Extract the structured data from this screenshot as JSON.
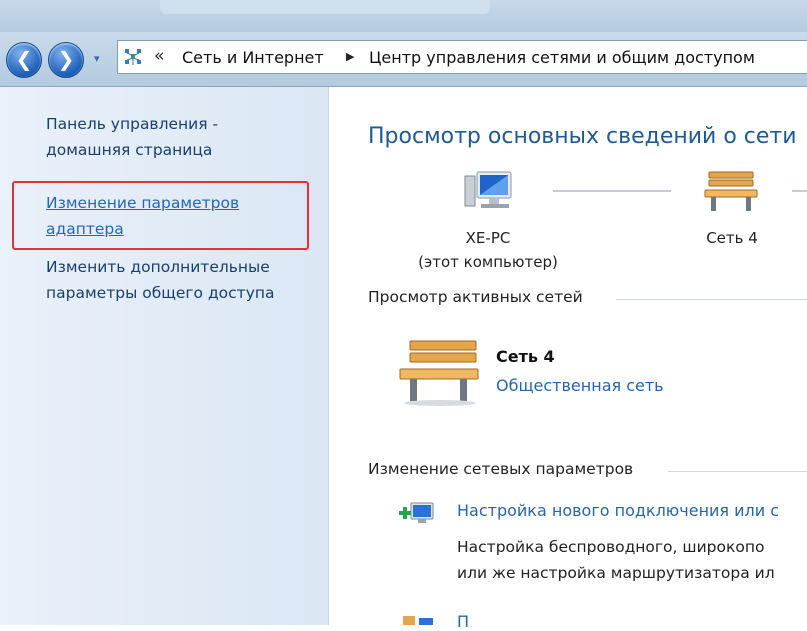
{
  "nav": {
    "back_icon": "back-arrow-icon",
    "forward_icon": "forward-arrow-icon",
    "back_glyph": "❮",
    "forward_glyph": "❯",
    "dropdown_glyph": "▾"
  },
  "address": {
    "overflow_glyph": "«",
    "separator_glyph": "▶",
    "crumbs": [
      "Сеть и Интернет",
      "Центр управления сетями и общим доступом"
    ]
  },
  "sidebar": {
    "items": [
      {
        "line1": "Панель управления -",
        "line2": "домашняя страница"
      },
      {
        "line1": "Изменение параметров",
        "line2": "адаптера"
      },
      {
        "line1": "Изменить дополнительные",
        "line2": "параметры общего доступа"
      }
    ]
  },
  "main": {
    "heading": "Просмотр основных сведений о сети",
    "map": {
      "computer_name": "XE-PC",
      "computer_sub": "(этот компьютер)",
      "network_name": "Сеть  4"
    },
    "active_header": "Просмотр активных сетей",
    "active_network": {
      "name": "Сеть  4",
      "type": "Общественная сеть"
    },
    "change_header": "Изменение сетевых параметров",
    "task1": {
      "title": "Настройка нового подключения или с",
      "desc1": "Настройка беспроводного, широкопо",
      "desc2": "или же настройка маршрутизатора ил"
    },
    "task2": {
      "title": "П"
    }
  },
  "colors": {
    "accent": "#1e5a96",
    "link": "#2366b0",
    "highlight_box": "#e8303a"
  }
}
